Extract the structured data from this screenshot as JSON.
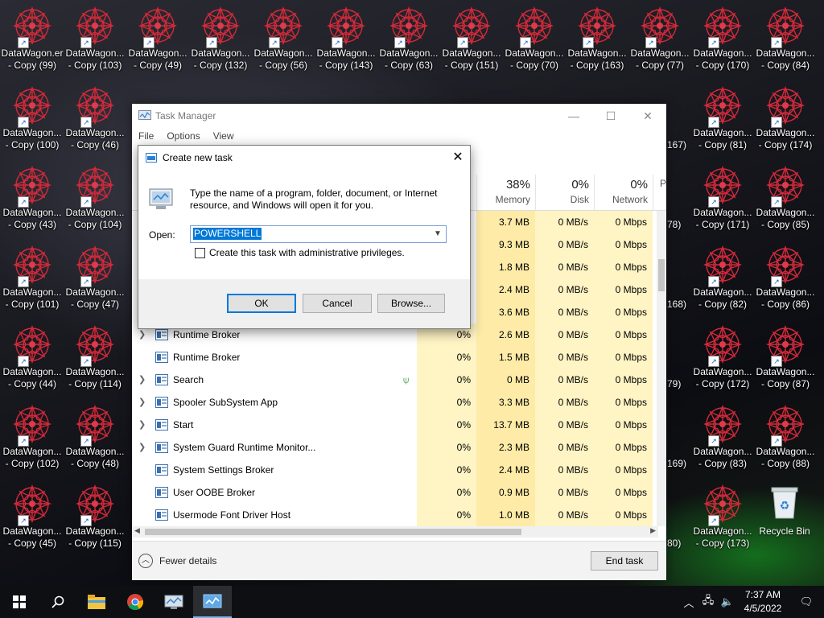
{
  "desktop": {
    "icon_name": "DataWagon...",
    "labels_top_row": [
      "DataWagon.er\n- Copy (99)",
      "DataWagon...\n- Copy (103)",
      "DataWagon...\n- Copy (49)",
      "DataWagon...\n- Copy (132)",
      "DataWagon...\n- Copy (56)",
      "DataWagon...\n- Copy (143)",
      "DataWagon...\n- Copy (63)",
      "DataWagon...\n- Copy (151)",
      "DataWagon...\n- Copy (70)",
      "DataWagon...\n- Copy (163)",
      "DataWagon...\n- Copy (77)",
      "DataWagon...\n- Copy (170)",
      "DataWagon...\n- Copy (84)"
    ],
    "left_col1": [
      "DataWagon...\n- Copy (100)",
      "DataWagon...\n- Copy (43)",
      "DataWagon...\n- Copy (101)",
      "DataWagon...\n- Copy (44)",
      "DataWagon...\n- Copy (102)",
      "DataWagon...\n- Copy (45)"
    ],
    "left_col2": [
      "DataWagon...\n- Copy (46)",
      "DataWagon...\n- Copy (104)",
      "DataWagon...\n- Copy (47)",
      "DataWagon...\n- Copy (114)",
      "DataWagon...\n- Copy (48)",
      "DataWagon...\n- Copy (115)"
    ],
    "right_col1_partial": [
      "167)",
      "78)",
      "168)",
      "79)",
      "169)",
      "80)"
    ],
    "right_col2": [
      "DataWagon...\n- Copy (81)",
      "DataWagon...\n- Copy (171)",
      "DataWagon...\n- Copy (82)",
      "DataWagon...\n- Copy (172)",
      "DataWagon...\n- Copy (83)",
      "DataWagon...\n- Copy (173)"
    ],
    "right_col3": [
      "DataWagon...\n- Copy (174)",
      "DataWagon...\n- Copy (85)",
      "DataWagon...\n- Copy (86)",
      "DataWagon...\n- Copy (87)",
      "DataWagon...\n- Copy (88)",
      "Recycle Bin"
    ]
  },
  "task_manager": {
    "title": "Task Manager",
    "menu": [
      "File",
      "Options",
      "View"
    ],
    "columns": [
      {
        "pct": "38%",
        "name": "Memory"
      },
      {
        "pct": "0%",
        "name": "Disk"
      },
      {
        "pct": "0%",
        "name": "Network"
      },
      {
        "pct": "",
        "name": "P"
      }
    ],
    "hidden_rows": [
      {
        "mem": "3.7 MB",
        "disk": "0 MB/s",
        "net": "0 Mbps"
      },
      {
        "mem": "9.3 MB",
        "disk": "0 MB/s",
        "net": "0 Mbps"
      },
      {
        "mem": "1.8 MB",
        "disk": "0 MB/s",
        "net": "0 Mbps"
      },
      {
        "mem": "2.4 MB",
        "disk": "0 MB/s",
        "net": "0 Mbps"
      },
      {
        "mem": "3.6 MB",
        "disk": "0 MB/s",
        "net": "0 Mbps"
      }
    ],
    "rows": [
      {
        "name": "Runtime Broker",
        "expand": true,
        "cpu": "0%",
        "mem": "2.6 MB",
        "disk": "0 MB/s",
        "net": "0 Mbps"
      },
      {
        "name": "Runtime Broker",
        "expand": false,
        "cpu": "0%",
        "mem": "1.5 MB",
        "disk": "0 MB/s",
        "net": "0 Mbps"
      },
      {
        "name": "Search",
        "expand": true,
        "cpu": "0%",
        "mem": "0 MB",
        "disk": "0 MB/s",
        "net": "0 Mbps",
        "leaf": true
      },
      {
        "name": "Spooler SubSystem App",
        "expand": true,
        "cpu": "0%",
        "mem": "3.3 MB",
        "disk": "0 MB/s",
        "net": "0 Mbps"
      },
      {
        "name": "Start",
        "expand": true,
        "cpu": "0%",
        "mem": "13.7 MB",
        "disk": "0 MB/s",
        "net": "0 Mbps"
      },
      {
        "name": "System Guard Runtime Monitor...",
        "expand": true,
        "cpu": "0%",
        "mem": "2.3 MB",
        "disk": "0 MB/s",
        "net": "0 Mbps"
      },
      {
        "name": "System Settings Broker",
        "expand": false,
        "cpu": "0%",
        "mem": "2.4 MB",
        "disk": "0 MB/s",
        "net": "0 Mbps"
      },
      {
        "name": "User OOBE Broker",
        "expand": false,
        "cpu": "0%",
        "mem": "0.9 MB",
        "disk": "0 MB/s",
        "net": "0 Mbps"
      },
      {
        "name": "Usermode Font Driver Host",
        "expand": false,
        "cpu": "0%",
        "mem": "1.0 MB",
        "disk": "0 MB/s",
        "net": "0 Mbps"
      }
    ],
    "fewer_details": "Fewer details",
    "end_task": "End task"
  },
  "run_dialog": {
    "title": "Create new task",
    "description": "Type the name of a program, folder, document, or Internet resource, and Windows will open it for you.",
    "open_label": "Open:",
    "open_value": "POWERSHELL",
    "admin_checkbox": "Create this task with administrative privileges.",
    "ok": "OK",
    "cancel": "Cancel",
    "browse": "Browse..."
  },
  "taskbar": {
    "time": "7:37 AM",
    "date": "4/5/2022",
    "icons": [
      "windows-start-icon",
      "search-icon",
      "file-explorer-icon",
      "chrome-icon",
      "run-app-icon",
      "task-manager-icon"
    ]
  }
}
